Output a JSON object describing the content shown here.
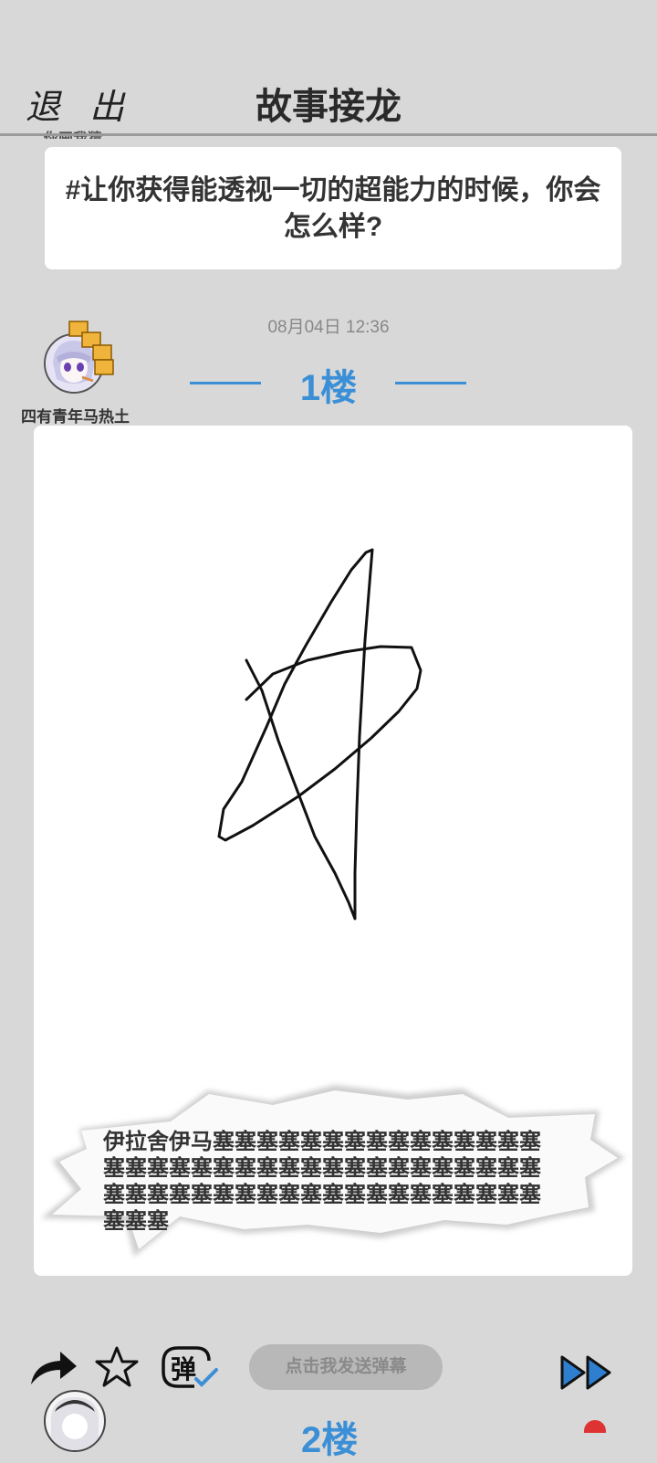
{
  "header": {
    "exit_label": "退 出",
    "title": "故事接龙",
    "cut_off_text": "你画我猜"
  },
  "topic": {
    "text": "#让你获得能透视一切的超能力的时候，你会怎么样?"
  },
  "post": {
    "timestamp": "08月04日 12:36",
    "floor_label": "1楼",
    "username": "四有青年马热土",
    "caption": "伊拉舍伊马塞塞塞塞塞塞塞塞塞塞塞塞塞塞塞塞塞塞塞塞塞塞塞塞塞塞塞塞塞塞塞塞塞塞塞塞塞塞塞塞塞塞塞塞塞塞塞塞塞塞塞塞塞塞塞塞塞塞"
  },
  "toolbar": {
    "share_icon": "share-arrow-icon",
    "favorite_icon": "star-icon",
    "danmaku_toggle_label": "弹",
    "danmaku_placeholder": "点击我发送弹幕",
    "fast_forward_icon": "fast-forward-icon"
  },
  "next_post": {
    "floor_label": "2楼"
  },
  "colors": {
    "background": "#d8d8d8",
    "accent_blue": "#3b8fd6",
    "card": "#ffffff"
  }
}
